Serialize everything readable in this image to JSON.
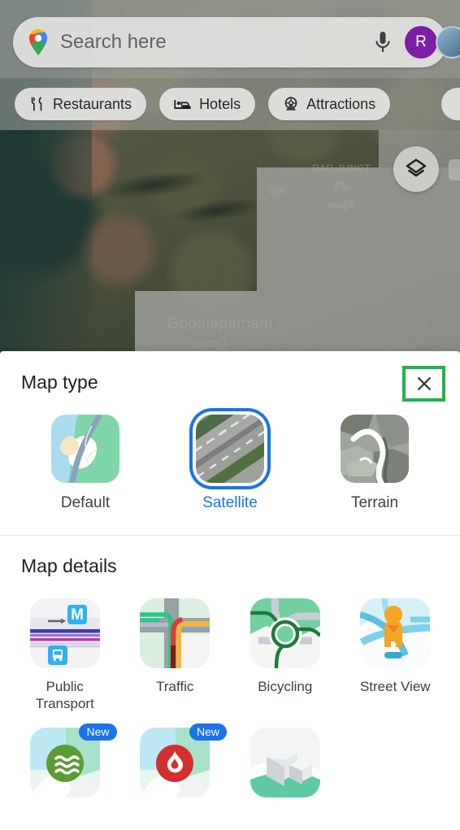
{
  "app": {
    "name": "Google Maps"
  },
  "search": {
    "placeholder": "Search here",
    "value": "",
    "logo_icon": "google-maps-pin-icon",
    "mic_icon": "microphone-icon",
    "avatar_initial": "R",
    "avatar_color": "#7b1fa2"
  },
  "chips": [
    {
      "label": "Restaurants",
      "icon": "restaurant-icon"
    },
    {
      "label": "Hotels",
      "icon": "hotel-bed-icon"
    },
    {
      "label": "Attractions",
      "icon": "ferris-wheel-icon"
    }
  ],
  "map": {
    "layers_button_icon": "layers-icon",
    "labels": {
      "junction": "RAD JUNCT",
      "telugu_1": "రోడ్",
      "telugu_2": "జంక్షన్",
      "route": "109",
      "place": "Gopalapatnam",
      "place_sub": "(rural)"
    }
  },
  "sheet": {
    "map_type": {
      "title": "Map type",
      "close_icon": "close-icon",
      "options": [
        {
          "label": "Default",
          "selected": false,
          "icon": "default-map-thumb"
        },
        {
          "label": "Satellite",
          "selected": true,
          "icon": "satellite-map-thumb"
        },
        {
          "label": "Terrain",
          "selected": false,
          "icon": "terrain-map-thumb"
        }
      ],
      "selected_value": "Satellite",
      "selected_color": "#1a73e8",
      "highlight_color": "#21b24b"
    },
    "map_details": {
      "title": "Map details",
      "items": [
        {
          "label": "Public\nTransport",
          "label_line1": "Public",
          "label_line2": "Transport",
          "icon": "public-transport-thumb",
          "badge": ""
        },
        {
          "label": "Traffic",
          "label_line1": "Traffic",
          "label_line2": "",
          "icon": "traffic-thumb",
          "badge": ""
        },
        {
          "label": "Bicycling",
          "label_line1": "Bicycling",
          "label_line2": "",
          "icon": "bicycling-thumb",
          "badge": ""
        },
        {
          "label": "Street View",
          "label_line1": "Street View",
          "label_line2": "",
          "icon": "street-view-thumb",
          "badge": ""
        },
        {
          "label": "",
          "label_line1": "",
          "label_line2": "",
          "icon": "air-quality-thumb",
          "badge": "New"
        },
        {
          "label": "",
          "label_line1": "",
          "label_line2": "",
          "icon": "wildfires-thumb",
          "badge": "New"
        },
        {
          "label": "",
          "label_line1": "",
          "label_line2": "",
          "icon": "3d-buildings-thumb",
          "badge": ""
        }
      ]
    }
  }
}
